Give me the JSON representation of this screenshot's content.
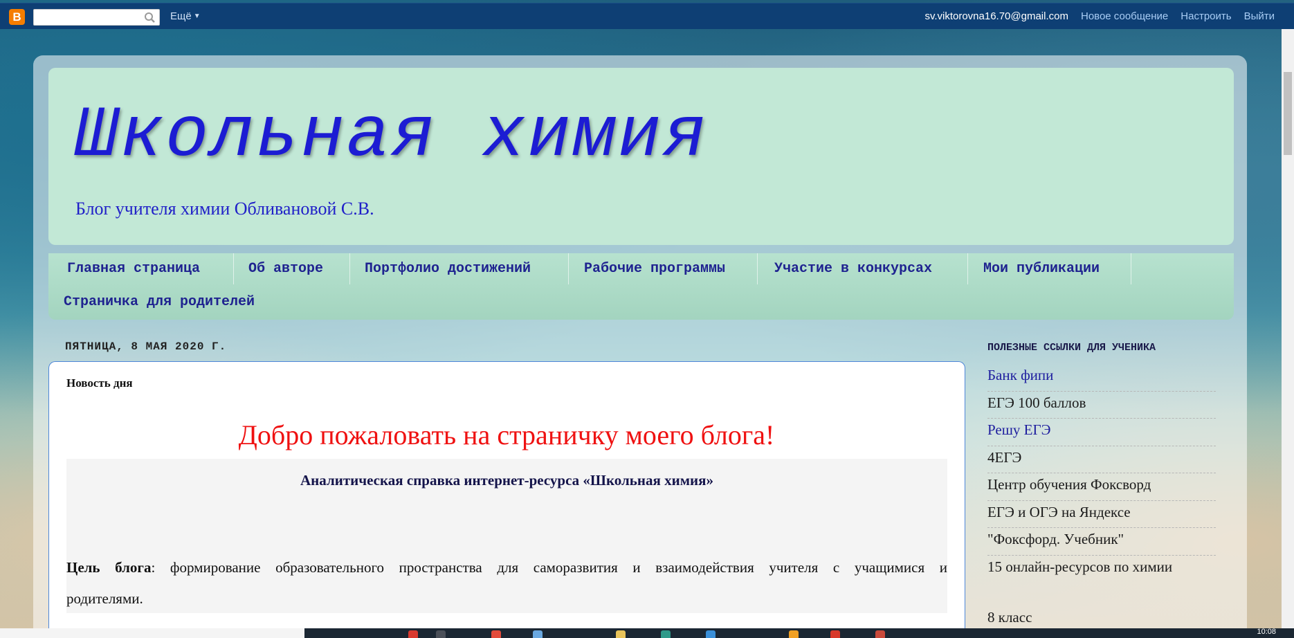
{
  "navbar": {
    "logo_letter": "B",
    "search_value": "",
    "more_label": "Ещё",
    "email": "sv.viktorovna16.70@gmail.com",
    "links": [
      "Новое сообщение",
      "Настроить",
      "Выйти"
    ]
  },
  "blog": {
    "title": "Школьная  химия",
    "description": "Блог учителя химии Обливановой С.В."
  },
  "tabs": [
    "Главная страница",
    "Об авторе",
    "Портфолио достижений",
    "Рабочие программы",
    "Участие в конкурсах",
    "Мои публикации",
    "Страничка для родителей"
  ],
  "post": {
    "date": "ПЯТНИЦА, 8 МАЯ 2020 Г.",
    "title": "Новость дня",
    "welcome": "Добро пожаловать на страничку моего блога!",
    "analytic": "Аналитическая справка интернет-ресурса  «Школьная химия»",
    "goal_label": "Цель блога",
    "goal_text": ":  формирование образовательного пространства для саморазвития и взаимодействия учителя с учащимися и",
    "goal_text_2": "родителями."
  },
  "sidebar": {
    "title": "ПОЛЕЗНЫЕ ССЫЛКИ ДЛЯ УЧЕНИКА",
    "links": [
      "Банк фипи",
      "ЕГЭ 100 баллов",
      "Решу ЕГЭ",
      "4ЕГЭ",
      "Центр обучения Фоксворд",
      "ЕГЭ и ОГЭ на Яндексе",
      "\"Фоксфорд. Учебник\"",
      "15 онлайн-ресурсов по химии"
    ],
    "next_section": "8 класс"
  },
  "taskbar": {
    "clock": "10:08"
  },
  "colors": {
    "navbar_bg": "#0e3f74",
    "header_bg": "#c2e8d6",
    "title_color": "#1c1cd3",
    "welcome_color": "#ef1111",
    "tab_text": "#1f2390"
  }
}
